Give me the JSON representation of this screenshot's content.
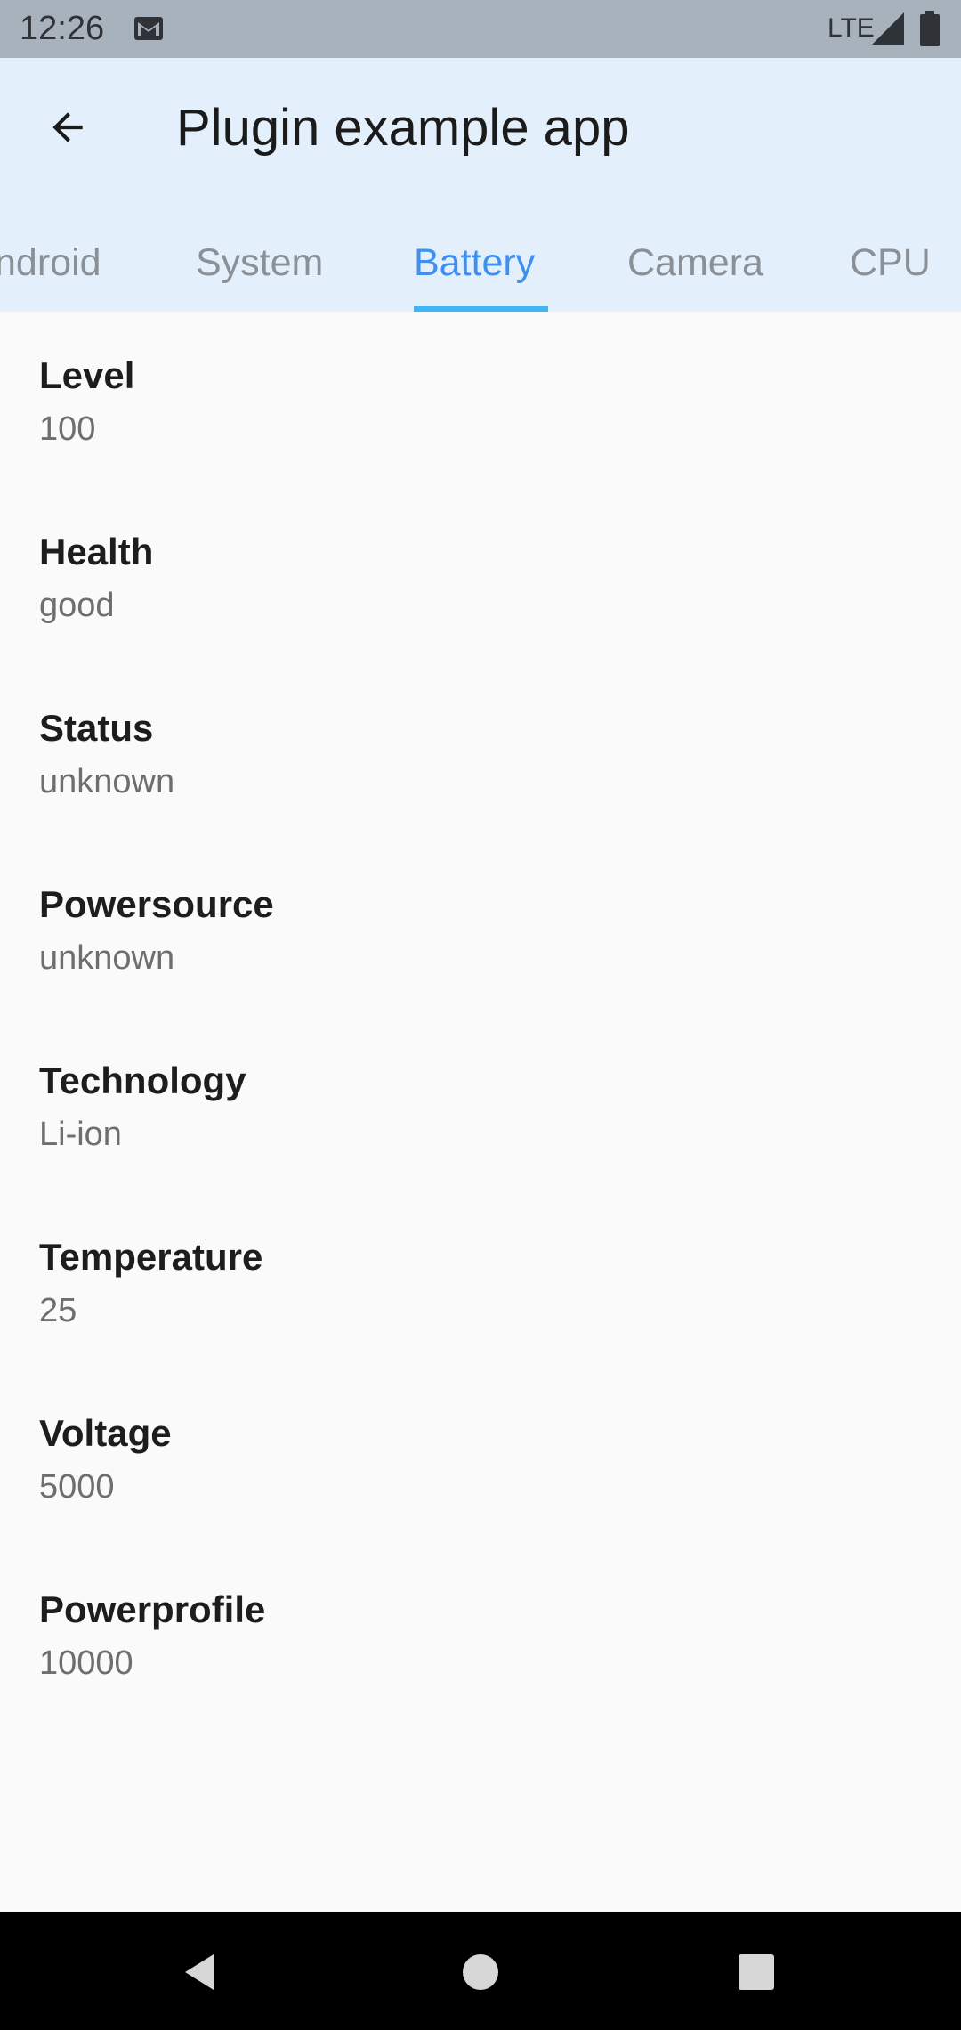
{
  "status_bar": {
    "time": "12:26",
    "network": "LTE",
    "icons": [
      "gmail-icon",
      "signal-icon",
      "battery-icon"
    ]
  },
  "app_bar": {
    "title": "Plugin example app",
    "back_icon": "arrow-back-icon"
  },
  "tabs": [
    {
      "label": "ndroid",
      "active": false
    },
    {
      "label": "System",
      "active": false
    },
    {
      "label": "Battery",
      "active": true
    },
    {
      "label": "Camera",
      "active": false
    },
    {
      "label": "CPU",
      "active": false
    }
  ],
  "battery": [
    {
      "label": "Level",
      "value": "100"
    },
    {
      "label": "Health",
      "value": "good"
    },
    {
      "label": "Status",
      "value": "unknown"
    },
    {
      "label": "Powersource",
      "value": "unknown"
    },
    {
      "label": "Technology",
      "value": "Li-ion"
    },
    {
      "label": "Temperature",
      "value": "25"
    },
    {
      "label": "Voltage",
      "value": "5000"
    },
    {
      "label": "Powerprofile",
      "value": "10000"
    }
  ],
  "colors": {
    "status_bar": "#a8b2bd",
    "app_bar": "#e3f0fb",
    "active_tab": "#3f8ff0",
    "indicator": "#41b6f5",
    "background": "#fafafa",
    "nav_bar": "#000000"
  },
  "nav_bar": {
    "icons": [
      "back-triangle-icon",
      "home-circle-icon",
      "recents-square-icon"
    ]
  }
}
